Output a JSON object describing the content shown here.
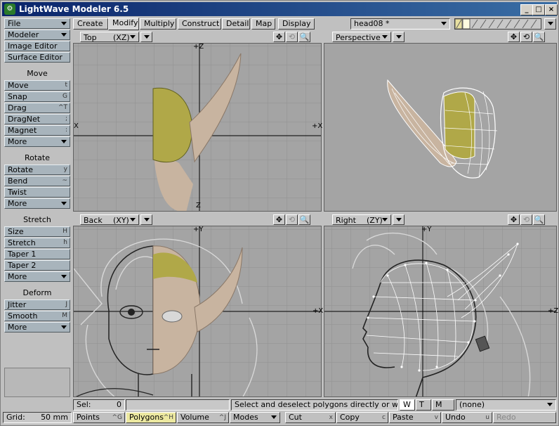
{
  "app": {
    "title": "LightWave Modeler 6.5"
  },
  "window_controls": {
    "minimize": "_",
    "maximize": "□",
    "close": "×"
  },
  "sidebar": {
    "file": "File",
    "modeler": "Modeler",
    "image_editor": "Image Editor",
    "surface_editor": "Surface Editor",
    "groups": [
      {
        "header": "Move",
        "items": [
          {
            "label": "Move",
            "shortcut": "t"
          },
          {
            "label": "Snap",
            "shortcut": "G"
          },
          {
            "label": "Drag",
            "shortcut": "^T"
          },
          {
            "label": "DragNet",
            "shortcut": ";"
          },
          {
            "label": "Magnet",
            "shortcut": ":"
          },
          {
            "label": "More",
            "shortcut": ""
          }
        ]
      },
      {
        "header": "Rotate",
        "items": [
          {
            "label": "Rotate",
            "shortcut": "y"
          },
          {
            "label": "Bend",
            "shortcut": "~"
          },
          {
            "label": "Twist",
            "shortcut": ""
          },
          {
            "label": "More",
            "shortcut": ""
          }
        ]
      },
      {
        "header": "Stretch",
        "items": [
          {
            "label": "Size",
            "shortcut": "H"
          },
          {
            "label": "Stretch",
            "shortcut": "h"
          },
          {
            "label": "Taper 1",
            "shortcut": ""
          },
          {
            "label": "Taper 2",
            "shortcut": ""
          },
          {
            "label": "More",
            "shortcut": ""
          }
        ]
      },
      {
        "header": "Deform",
        "items": [
          {
            "label": "Jitter",
            "shortcut": "J"
          },
          {
            "label": "Smooth",
            "shortcut": "M"
          },
          {
            "label": "More",
            "shortcut": ""
          }
        ]
      }
    ]
  },
  "tabs": [
    "Create",
    "Modify",
    "Multiply",
    "Construct",
    "Detail",
    "Map",
    "Display"
  ],
  "active_tab": "Modify",
  "object_select": "head08 *",
  "viewports": [
    {
      "name": "Top",
      "axes": "(XZ)",
      "axis_h": "X",
      "axis_v": "Z"
    },
    {
      "name": "Perspective",
      "axes": "",
      "axis_h": "",
      "axis_v": ""
    },
    {
      "name": "Back",
      "axes": "(XY)",
      "axis_h": "X",
      "axis_v": "Y"
    },
    {
      "name": "Right",
      "axes": "(ZY)",
      "axis_h": "Z",
      "axis_v": "Y"
    }
  ],
  "viewport_icons": {
    "move": "✥",
    "rotate": "⟲",
    "zoom": "🔍"
  },
  "axis_labels": {
    "top_h_left": "X",
    "top_h_right": "+X",
    "top_v_top": "+Z",
    "top_v_bot": "Z",
    "back_h_right": "+X",
    "back_v_top": "+Y",
    "right_h_right": "+Z",
    "right_v_top": "+Y"
  },
  "status": {
    "sel_label": "Sel:",
    "sel_value": "0",
    "message": "Select and deselect polygons directly or with las...",
    "wtm": [
      "W",
      "T",
      "M"
    ],
    "layer": "(none)"
  },
  "bottom": {
    "grid_label": "Grid:",
    "grid_value": "50 mm",
    "points": {
      "label": "Points",
      "shortcut": "^G"
    },
    "polygons": {
      "label": "Polygons",
      "shortcut": "^H"
    },
    "volume": {
      "label": "Volume",
      "shortcut": "^J"
    },
    "modes": "Modes",
    "cut": {
      "label": "Cut",
      "shortcut": "x"
    },
    "copy": {
      "label": "Copy",
      "shortcut": "c"
    },
    "paste": {
      "label": "Paste",
      "shortcut": "v"
    },
    "undo": {
      "label": "Undo",
      "shortcut": "u"
    },
    "redo": "Redo"
  },
  "colors": {
    "accent": "#0a246a",
    "button": "#a8b4bc",
    "viewport_bg": "#a4a4a4",
    "skin": "#c8b4a0",
    "hair": "#b0a848",
    "wire": "#ffffff",
    "polygons_active": "#e8e000"
  }
}
